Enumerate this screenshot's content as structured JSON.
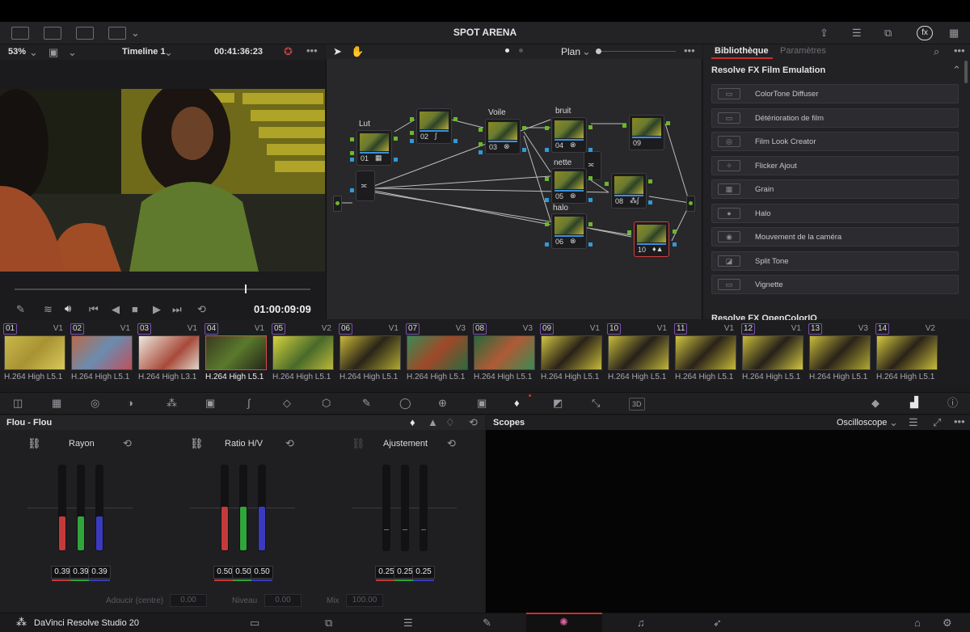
{
  "app": {
    "name": "DaVinci Resolve Studio 20",
    "project_title": "SPOT ARENA"
  },
  "viewer": {
    "zoom": "53%",
    "timeline": "Timeline 1",
    "source_timecode": "00:41:36:23",
    "timecode": "01:00:09:09"
  },
  "node_editor": {
    "mode": "Plan",
    "nodes": [
      {
        "num": "01",
        "label": "Lut"
      },
      {
        "num": "02",
        "label": ""
      },
      {
        "num": "03",
        "label": "Voile"
      },
      {
        "num": "04",
        "label": "bruit"
      },
      {
        "num": "05",
        "label": "nette"
      },
      {
        "num": "06",
        "label": "halo"
      },
      {
        "num": "08",
        "label": ""
      },
      {
        "num": "09",
        "label": ""
      },
      {
        "num": "10",
        "label": ""
      }
    ]
  },
  "library": {
    "tab_library": "Bibliothèque",
    "tab_params": "Paramètres",
    "section": "Resolve FX Film Emulation",
    "next_section": "Resolve FX OpenColorIO",
    "effects": [
      "ColorTone Diffuser",
      "Détérioration de film",
      "Film Look Creator",
      "Flicker Ajout",
      "Grain",
      "Halo",
      "Mouvement de la caméra",
      "Split Tone",
      "Vignette"
    ]
  },
  "clips": [
    {
      "num": "01",
      "track": "V1",
      "codec": "H.264 High L5.1"
    },
    {
      "num": "02",
      "track": "V1",
      "codec": "H.264 High L5.1"
    },
    {
      "num": "03",
      "track": "V1",
      "codec": "H.264 High L3.1"
    },
    {
      "num": "04",
      "track": "V1",
      "codec": "H.264 High L5.1"
    },
    {
      "num": "05",
      "track": "V2",
      "codec": "H.264 High L5.1"
    },
    {
      "num": "06",
      "track": "V1",
      "codec": "H.264 High L5.1"
    },
    {
      "num": "07",
      "track": "V3",
      "codec": "H.264 High L5.1"
    },
    {
      "num": "08",
      "track": "V3",
      "codec": "H.264 High L5.1"
    },
    {
      "num": "09",
      "track": "V1",
      "codec": "H.264 High L5.1"
    },
    {
      "num": "10",
      "track": "V1",
      "codec": "H.264 High L5.1"
    },
    {
      "num": "11",
      "track": "V1",
      "codec": "H.264 High L5.1"
    },
    {
      "num": "12",
      "track": "V1",
      "codec": "H.264 High L5.1"
    },
    {
      "num": "13",
      "track": "V3",
      "codec": "H.264 High L5.1"
    },
    {
      "num": "14",
      "track": "V2",
      "codec": "H.264 High L5.1"
    }
  ],
  "blur_panel": {
    "title": "Flou - Flou",
    "groups": [
      {
        "label": "Rayon",
        "values": [
          "0.39",
          "0.39",
          "0.39"
        ],
        "level": 0.39
      },
      {
        "label": "Ratio H/V",
        "values": [
          "0.50",
          "0.50",
          "0.50"
        ],
        "level": 0.5
      },
      {
        "label": "Ajustement",
        "values": [
          "0.25",
          "0.25",
          "0.25"
        ],
        "level": 0.25
      }
    ],
    "footer": {
      "soften_label": "Adoucir (centre)",
      "soften_value": "0.00",
      "level_label": "Niveau",
      "level_value": "0.00",
      "mix_label": "Mix",
      "mix_value": "100.00"
    }
  },
  "scopes": {
    "title": "Scopes",
    "mode": "Oscilloscope"
  },
  "colors": {
    "accent_red": "#d13d3d",
    "node_link": "#3a8ee0",
    "pin_green": "#6ab82a"
  }
}
